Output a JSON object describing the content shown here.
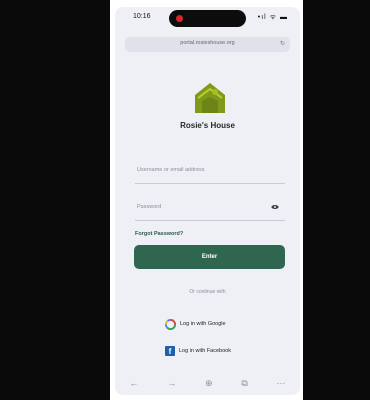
{
  "status_bar": {
    "time": "10:16",
    "icons": "•ıl ᯤ ▬"
  },
  "browser": {
    "url": "portal.rosieshouse.org",
    "refresh_icon": "refresh-icon"
  },
  "login": {
    "app_name": "Rosie's House",
    "email_placeholder": "Username or email address",
    "password_placeholder": "Password",
    "forgot_label": "Forgot Password?",
    "submit_label": "Enter",
    "divider_text": "Or continue with",
    "google_label": "Log in with Google",
    "facebook_label": "Log in with Facebook"
  },
  "toolbar": {
    "back": "←",
    "forward": "→",
    "add": "⊕",
    "tabs": "⧉",
    "more": "···"
  },
  "colors": {
    "primary": "#2f6650",
    "logo": "#7f9a1b",
    "background": "#eef0f5"
  }
}
